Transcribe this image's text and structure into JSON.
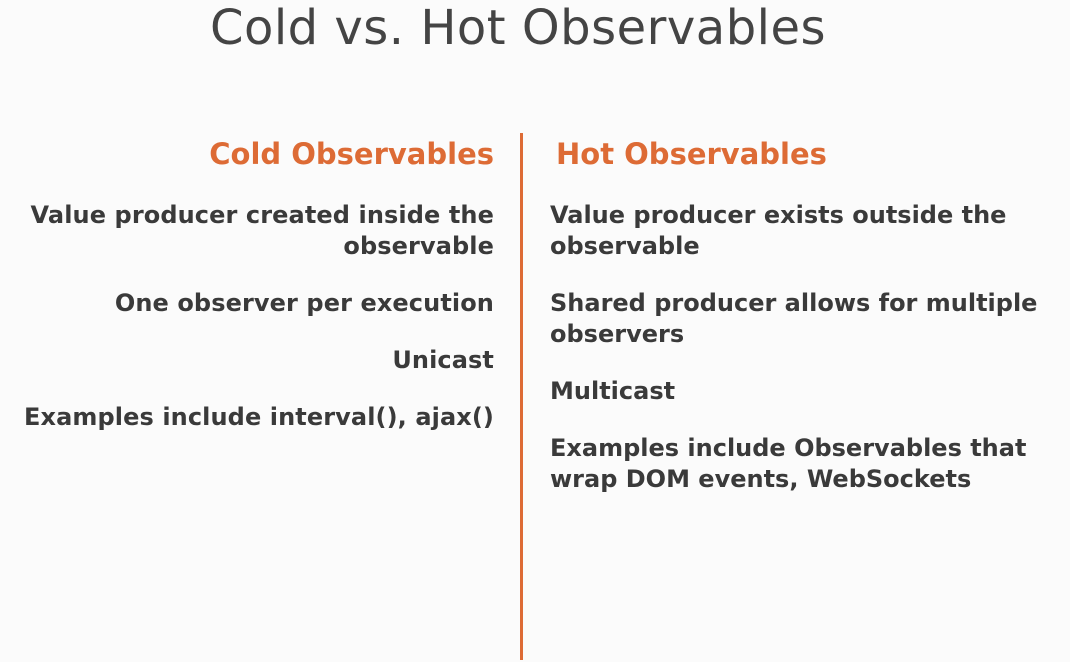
{
  "slide": {
    "title": "Cold vs. Hot Observables"
  },
  "cold": {
    "heading": "Cold Observables",
    "items": [
      "Value producer created inside the observable",
      "One observer per execution",
      "Unicast",
      "Examples include interval(), ajax()"
    ]
  },
  "hot": {
    "heading": "Hot Observables",
    "items": [
      "Value producer exists outside the observable",
      "Shared producer allows for multiple observers",
      "Multicast",
      "Examples include Observables that wrap DOM events, WebSockets"
    ]
  },
  "colors": {
    "accent": "#dd6b35",
    "text": "#3a3a3a",
    "background": "#fbfbfb"
  }
}
